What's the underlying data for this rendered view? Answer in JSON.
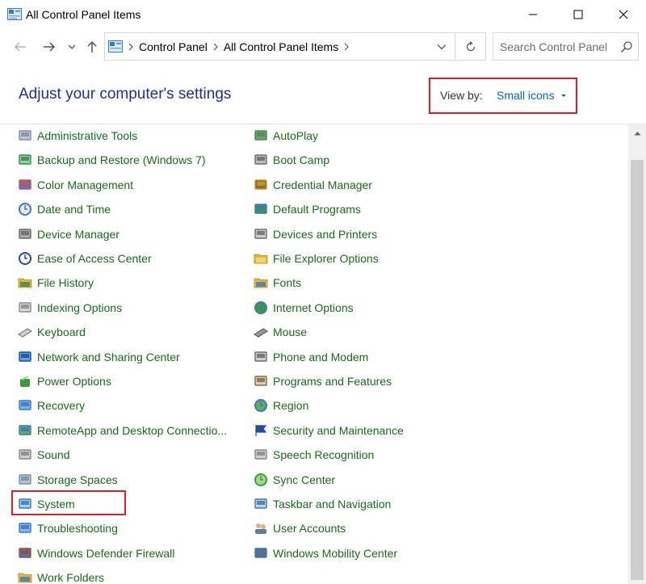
{
  "window": {
    "title": "All Control Panel Items",
    "minimize_symbol": "—",
    "maximize_symbol": "☐",
    "close_symbol": "✕"
  },
  "nav": {
    "back_icon": "back-arrow-icon",
    "forward_icon": "forward-arrow-icon",
    "recent_icon": "chevron-down-icon",
    "up_icon": "up-arrow-icon"
  },
  "address": {
    "crumbs": [
      "Control Panel",
      "All Control Panel Items"
    ]
  },
  "search": {
    "placeholder": "Search Control Panel"
  },
  "header": {
    "title": "Adjust your computer's settings",
    "view_by_label": "View by:",
    "view_by_value": "Small icons"
  },
  "colors": {
    "accent_red": "#d4212f",
    "link_green": "#1a6b1a",
    "heading_blue": "#1e3287",
    "view_blue": "#0066cc"
  },
  "items_left": [
    {
      "label": "Administrative Tools",
      "icon": "admin-tools-icon"
    },
    {
      "label": "Backup and Restore (Windows 7)",
      "icon": "backup-icon"
    },
    {
      "label": "Color Management",
      "icon": "color-management-icon"
    },
    {
      "label": "Date and Time",
      "icon": "clock-icon"
    },
    {
      "label": "Device Manager",
      "icon": "device-manager-icon"
    },
    {
      "label": "Ease of Access Center",
      "icon": "ease-of-access-icon"
    },
    {
      "label": "File History",
      "icon": "file-history-icon"
    },
    {
      "label": "Indexing Options",
      "icon": "indexing-icon"
    },
    {
      "label": "Keyboard",
      "icon": "keyboard-icon"
    },
    {
      "label": "Network and Sharing Center",
      "icon": "network-icon"
    },
    {
      "label": "Power Options",
      "icon": "power-icon"
    },
    {
      "label": "Recovery",
      "icon": "recovery-icon"
    },
    {
      "label": "RemoteApp and Desktop Connectio...",
      "icon": "remoteapp-icon"
    },
    {
      "label": "Sound",
      "icon": "sound-icon"
    },
    {
      "label": "Storage Spaces",
      "icon": "storage-icon"
    },
    {
      "label": "System",
      "icon": "system-icon"
    },
    {
      "label": "Troubleshooting",
      "icon": "troubleshooting-icon"
    },
    {
      "label": "Windows Defender Firewall",
      "icon": "firewall-icon"
    },
    {
      "label": "Work Folders",
      "icon": "work-folders-icon"
    }
  ],
  "items_right": [
    {
      "label": "AutoPlay",
      "icon": "autoplay-icon"
    },
    {
      "label": "Boot Camp",
      "icon": "boot-camp-icon"
    },
    {
      "label": "Credential Manager",
      "icon": "credential-icon"
    },
    {
      "label": "Default Programs",
      "icon": "default-programs-icon"
    },
    {
      "label": "Devices and Printers",
      "icon": "printer-icon"
    },
    {
      "label": "File Explorer Options",
      "icon": "folder-options-icon"
    },
    {
      "label": "Fonts",
      "icon": "fonts-icon"
    },
    {
      "label": "Internet Options",
      "icon": "internet-icon"
    },
    {
      "label": "Mouse",
      "icon": "mouse-icon"
    },
    {
      "label": "Phone and Modem",
      "icon": "phone-icon"
    },
    {
      "label": "Programs and Features",
      "icon": "programs-icon"
    },
    {
      "label": "Region",
      "icon": "region-icon"
    },
    {
      "label": "Security and Maintenance",
      "icon": "flag-icon"
    },
    {
      "label": "Speech Recognition",
      "icon": "microphone-icon"
    },
    {
      "label": "Sync Center",
      "icon": "sync-icon"
    },
    {
      "label": "Taskbar and Navigation",
      "icon": "taskbar-icon"
    },
    {
      "label": "User Accounts",
      "icon": "users-icon"
    },
    {
      "label": "Windows Mobility Center",
      "icon": "mobility-icon"
    }
  ]
}
